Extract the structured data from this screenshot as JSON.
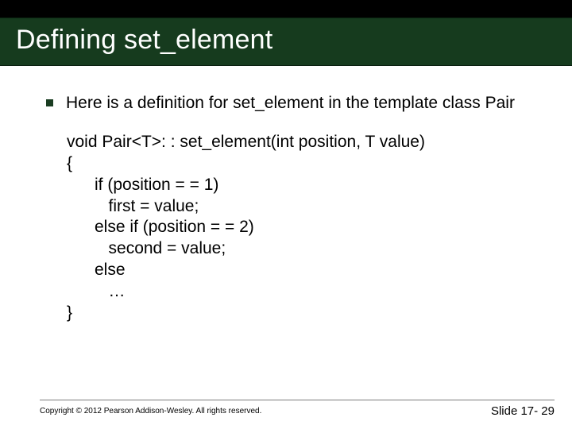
{
  "title": "Defining set_element",
  "bullet": {
    "text": "Here is a definition for set_element in the template class Pair"
  },
  "code": "void Pair<T>: : set_element(int position, T value)\n{\n      if (position = = 1)\n         first = value;\n      else if (position = = 2)\n         second = value;\n      else\n         …\n}",
  "footer": {
    "copyright": "Copyright © 2012 Pearson Addison-Wesley.  All rights reserved.",
    "slide_number": "Slide 17- 29"
  }
}
